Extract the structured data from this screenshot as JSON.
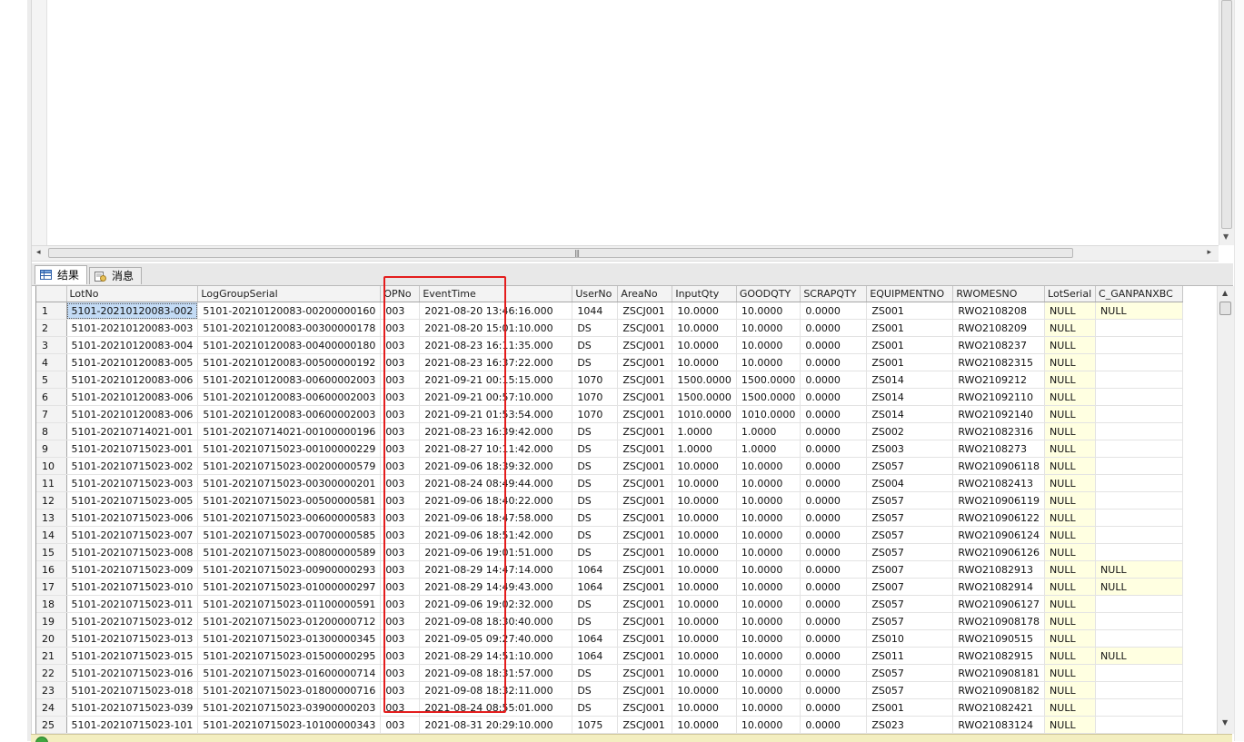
{
  "tabs": {
    "results": "结果",
    "messages": "消息"
  },
  "grid": {
    "columns": [
      "",
      "LotNo",
      "LogGroupSerial",
      "OPNo",
      "EventTime",
      "UserNo",
      "AreaNo",
      "InputQty",
      "GOODQTY",
      "SCRAPQTY",
      "EQUIPMENTNO",
      "RWOMESNO",
      "LotSerial",
      "C_GANPANXBC"
    ],
    "rows": [
      [
        "1",
        "5101-20210120083-002",
        "5101-20210120083-00200000160",
        "003",
        "2021-08-20 13:46:16.000",
        "1044",
        "ZSCJ001",
        "10.0000",
        "10.0000",
        "0.0000",
        "ZS001",
        "RWO2108208",
        "NULL",
        "NULL"
      ],
      [
        "2",
        "5101-20210120083-003",
        "5101-20210120083-00300000178",
        "003",
        "2021-08-20 15:01:10.000",
        "DS",
        "ZSCJ001",
        "10.0000",
        "10.0000",
        "0.0000",
        "ZS001",
        "RWO2108209",
        "NULL",
        ""
      ],
      [
        "3",
        "5101-20210120083-004",
        "5101-20210120083-00400000180",
        "003",
        "2021-08-23 16:11:35.000",
        "DS",
        "ZSCJ001",
        "10.0000",
        "10.0000",
        "0.0000",
        "ZS001",
        "RWO2108237",
        "NULL",
        ""
      ],
      [
        "4",
        "5101-20210120083-005",
        "5101-20210120083-00500000192",
        "003",
        "2021-08-23 16:37:22.000",
        "DS",
        "ZSCJ001",
        "10.0000",
        "10.0000",
        "0.0000",
        "ZS001",
        "RWO21082315",
        "NULL",
        ""
      ],
      [
        "5",
        "5101-20210120083-006",
        "5101-20210120083-00600002003",
        "003",
        "2021-09-21 00:15:15.000",
        "1070",
        "ZSCJ001",
        "1500.0000",
        "1500.0000",
        "0.0000",
        "ZS014",
        "RWO2109212",
        "NULL",
        ""
      ],
      [
        "6",
        "5101-20210120083-006",
        "5101-20210120083-00600002003",
        "003",
        "2021-09-21 00:57:10.000",
        "1070",
        "ZSCJ001",
        "1500.0000",
        "1500.0000",
        "0.0000",
        "ZS014",
        "RWO21092110",
        "NULL",
        ""
      ],
      [
        "7",
        "5101-20210120083-006",
        "5101-20210120083-00600002003",
        "003",
        "2021-09-21 01:53:54.000",
        "1070",
        "ZSCJ001",
        "1010.0000",
        "1010.0000",
        "0.0000",
        "ZS014",
        "RWO21092140",
        "NULL",
        ""
      ],
      [
        "8",
        "5101-20210714021-001",
        "5101-20210714021-00100000196",
        "003",
        "2021-08-23 16:39:42.000",
        "DS",
        "ZSCJ001",
        "1.0000",
        "1.0000",
        "0.0000",
        "ZS002",
        "RWO21082316",
        "NULL",
        ""
      ],
      [
        "9",
        "5101-20210715023-001",
        "5101-20210715023-00100000229",
        "003",
        "2021-08-27 10:11:42.000",
        "DS",
        "ZSCJ001",
        "1.0000",
        "1.0000",
        "0.0000",
        "ZS003",
        "RWO2108273",
        "NULL",
        ""
      ],
      [
        "10",
        "5101-20210715023-002",
        "5101-20210715023-00200000579",
        "003",
        "2021-09-06 18:39:32.000",
        "DS",
        "ZSCJ001",
        "10.0000",
        "10.0000",
        "0.0000",
        "ZS057",
        "RWO210906118",
        "NULL",
        ""
      ],
      [
        "11",
        "5101-20210715023-003",
        "5101-20210715023-00300000201",
        "003",
        "2021-08-24 08:49:44.000",
        "DS",
        "ZSCJ001",
        "10.0000",
        "10.0000",
        "0.0000",
        "ZS004",
        "RWO21082413",
        "NULL",
        ""
      ],
      [
        "12",
        "5101-20210715023-005",
        "5101-20210715023-00500000581",
        "003",
        "2021-09-06 18:40:22.000",
        "DS",
        "ZSCJ001",
        "10.0000",
        "10.0000",
        "0.0000",
        "ZS057",
        "RWO210906119",
        "NULL",
        ""
      ],
      [
        "13",
        "5101-20210715023-006",
        "5101-20210715023-00600000583",
        "003",
        "2021-09-06 18:47:58.000",
        "DS",
        "ZSCJ001",
        "10.0000",
        "10.0000",
        "0.0000",
        "ZS057",
        "RWO210906122",
        "NULL",
        ""
      ],
      [
        "14",
        "5101-20210715023-007",
        "5101-20210715023-00700000585",
        "003",
        "2021-09-06 18:51:42.000",
        "DS",
        "ZSCJ001",
        "10.0000",
        "10.0000",
        "0.0000",
        "ZS057",
        "RWO210906124",
        "NULL",
        ""
      ],
      [
        "15",
        "5101-20210715023-008",
        "5101-20210715023-00800000589",
        "003",
        "2021-09-06 19:01:51.000",
        "DS",
        "ZSCJ001",
        "10.0000",
        "10.0000",
        "0.0000",
        "ZS057",
        "RWO210906126",
        "NULL",
        ""
      ],
      [
        "16",
        "5101-20210715023-009",
        "5101-20210715023-00900000293",
        "003",
        "2021-08-29 14:47:14.000",
        "1064",
        "ZSCJ001",
        "10.0000",
        "10.0000",
        "0.0000",
        "ZS007",
        "RWO21082913",
        "NULL",
        "NULL"
      ],
      [
        "17",
        "5101-20210715023-010",
        "5101-20210715023-01000000297",
        "003",
        "2021-08-29 14:49:43.000",
        "1064",
        "ZSCJ001",
        "10.0000",
        "10.0000",
        "0.0000",
        "ZS007",
        "RWO21082914",
        "NULL",
        "NULL"
      ],
      [
        "18",
        "5101-20210715023-011",
        "5101-20210715023-01100000591",
        "003",
        "2021-09-06 19:02:32.000",
        "DS",
        "ZSCJ001",
        "10.0000",
        "10.0000",
        "0.0000",
        "ZS057",
        "RWO210906127",
        "NULL",
        ""
      ],
      [
        "19",
        "5101-20210715023-012",
        "5101-20210715023-01200000712",
        "003",
        "2021-09-08 18:30:40.000",
        "DS",
        "ZSCJ001",
        "10.0000",
        "10.0000",
        "0.0000",
        "ZS057",
        "RWO210908178",
        "NULL",
        ""
      ],
      [
        "20",
        "5101-20210715023-013",
        "5101-20210715023-01300000345",
        "003",
        "2021-09-05 09:27:40.000",
        "1064",
        "ZSCJ001",
        "10.0000",
        "10.0000",
        "0.0000",
        "ZS010",
        "RWO21090515",
        "NULL",
        ""
      ],
      [
        "21",
        "5101-20210715023-015",
        "5101-20210715023-01500000295",
        "003",
        "2021-08-29 14:51:10.000",
        "1064",
        "ZSCJ001",
        "10.0000",
        "10.0000",
        "0.0000",
        "ZS011",
        "RWO21082915",
        "NULL",
        "NULL"
      ],
      [
        "22",
        "5101-20210715023-016",
        "5101-20210715023-01600000714",
        "003",
        "2021-09-08 18:31:57.000",
        "DS",
        "ZSCJ001",
        "10.0000",
        "10.0000",
        "0.0000",
        "ZS057",
        "RWO210908181",
        "NULL",
        ""
      ],
      [
        "23",
        "5101-20210715023-018",
        "5101-20210715023-01800000716",
        "003",
        "2021-09-08 18:32:11.000",
        "DS",
        "ZSCJ001",
        "10.0000",
        "10.0000",
        "0.0000",
        "ZS057",
        "RWO210908182",
        "NULL",
        ""
      ],
      [
        "24",
        "5101-20210715023-039",
        "5101-20210715023-03900000203",
        "003",
        "2021-08-24 08:55:01.000",
        "DS",
        "ZSCJ001",
        "10.0000",
        "10.0000",
        "0.0000",
        "ZS001",
        "RWO21082421",
        "NULL",
        ""
      ],
      [
        "25",
        "5101-20210715023-101",
        "5101-20210715023-10100000343",
        "003",
        "2021-08-31 20:29:10.000",
        "1075",
        "ZSCJ001",
        "10.0000",
        "10.0000",
        "0.0000",
        "ZS023",
        "RWO21083124",
        "NULL",
        ""
      ]
    ]
  },
  "colors": {
    "highlight_box": "#e41d1d",
    "null_cell": "#ffffe1",
    "selected_cell": "#c3dbf5"
  },
  "icons": {
    "results_tab": "grid-icon",
    "messages_tab": "message-icon",
    "status": "status-ok-icon"
  }
}
